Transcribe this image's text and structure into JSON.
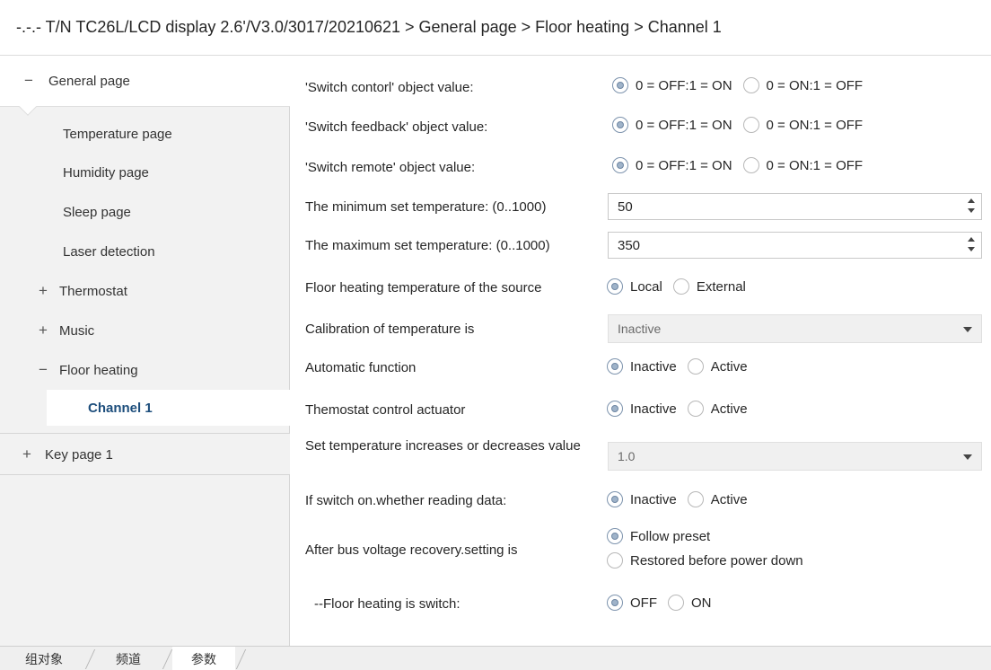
{
  "window": {
    "breadcrumb": "-.-.- T/N TC26L/LCD display 2.6'/V3.0/3017/20210621 > General page > Floor heating > Channel 1"
  },
  "sidebar": {
    "items": [
      {
        "label": "General page",
        "expander": "−"
      },
      {
        "label": "Temperature page",
        "expander": ""
      },
      {
        "label": "Humidity page",
        "expander": ""
      },
      {
        "label": "Sleep page",
        "expander": ""
      },
      {
        "label": "Laser detection",
        "expander": ""
      },
      {
        "label": "Thermostat",
        "expander": "+"
      },
      {
        "label": "Music",
        "expander": "+"
      },
      {
        "label": "Floor heating",
        "expander": "−"
      },
      {
        "label": "Channel 1",
        "expander": ""
      },
      {
        "label": "Key page 1",
        "expander": "+"
      }
    ]
  },
  "params": {
    "switch_control": {
      "label": "'Switch contorl' object value:",
      "options": [
        "0 = OFF:1 = ON",
        "0 = ON:1 = OFF"
      ],
      "selected": 0
    },
    "switch_feedback": {
      "label": "'Switch feedback' object value:",
      "options": [
        "0 = OFF:1 = ON",
        "0 = ON:1 = OFF"
      ],
      "selected": 0
    },
    "switch_remote": {
      "label": "'Switch remote' object value:",
      "options": [
        "0 = OFF:1 = ON",
        "0 = ON:1 = OFF"
      ],
      "selected": 0
    },
    "min_temp": {
      "label": "The minimum set temperature: (0..1000)",
      "value": "50"
    },
    "max_temp": {
      "label": "The maximum set temperature: (0..1000)",
      "value": "350"
    },
    "temp_source": {
      "label": "Floor heating temperature of the source",
      "options": [
        "Local",
        "External"
      ],
      "selected": 0
    },
    "calibration": {
      "label": "Calibration of temperature is",
      "value": "Inactive"
    },
    "automatic": {
      "label": "Automatic function",
      "options": [
        "Inactive",
        "Active"
      ],
      "selected": 0
    },
    "thermostat_actuator": {
      "label": "Themostat control actuator",
      "options": [
        "Inactive",
        "Active"
      ],
      "selected": 0
    },
    "step": {
      "label": "Set temperature increases or decreases value",
      "value": "1.0"
    },
    "reading_data": {
      "label": "If switch on.whether reading data:",
      "options": [
        "Inactive",
        "Active"
      ],
      "selected": 0
    },
    "bus_recovery": {
      "label": "After bus voltage recovery.setting is",
      "options": [
        "Follow preset",
        "Restored before power down"
      ],
      "selected": 0
    },
    "floor_switch": {
      "label": "--Floor heating is switch:",
      "options": [
        "OFF",
        "ON"
      ],
      "selected": 0
    }
  },
  "bottom_tabs": [
    "组对象",
    "频道",
    "参数"
  ],
  "bottom_active_tab": 2,
  "icons": {
    "radio_checked": "radio-checked-icon",
    "radio_unchecked": "radio-unchecked-icon",
    "spin_arrows": "spin-arrows-icon",
    "dropdown_caret": "chevron-down-icon",
    "tree_collapse": "minus-icon",
    "tree_expand": "plus-icon"
  },
  "colors": {
    "selected_tree_text": "#1d4e7c",
    "sidebar_bg": "#f2f2f2",
    "radio_checked_fill": "#9fb3c9"
  }
}
